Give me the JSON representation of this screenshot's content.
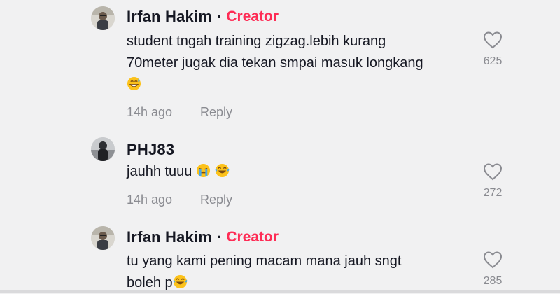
{
  "comments": [
    {
      "username": "Irfan Hakim",
      "separator": "·",
      "badge": "Creator",
      "text_lines": [
        "student tngah training zigzag.lebih kurang",
        "70meter jugak dia tekan smpai masuk longkang"
      ],
      "emojis": [
        "grinning-sweat-emoji"
      ],
      "time": "14h ago",
      "reply_label": "Reply",
      "likes": "625",
      "avatar_icon": "avatar-photo"
    },
    {
      "username": "PHJ83",
      "text_lines": [
        "jauhh tuuu "
      ],
      "emojis": [
        "loudly-crying-emoji",
        "tears-of-joy-emoji"
      ],
      "time": "14h ago",
      "reply_label": "Reply",
      "likes": "272",
      "avatar_icon": "avatar-photo"
    },
    {
      "username": "Irfan Hakim",
      "separator": "·",
      "badge": "Creator",
      "text_lines": [
        "tu yang kami pening macam mana jauh sngt",
        "boleh p"
      ],
      "emojis": [
        "tears-of-joy-emoji"
      ],
      "likes": "285",
      "avatar_icon": "avatar-photo"
    }
  ],
  "colors": {
    "background": "#f1f1f2",
    "creator_badge": "#fe2c55",
    "meta_text": "#8a8b91"
  },
  "icons": {
    "like": "heart-outline-icon"
  }
}
